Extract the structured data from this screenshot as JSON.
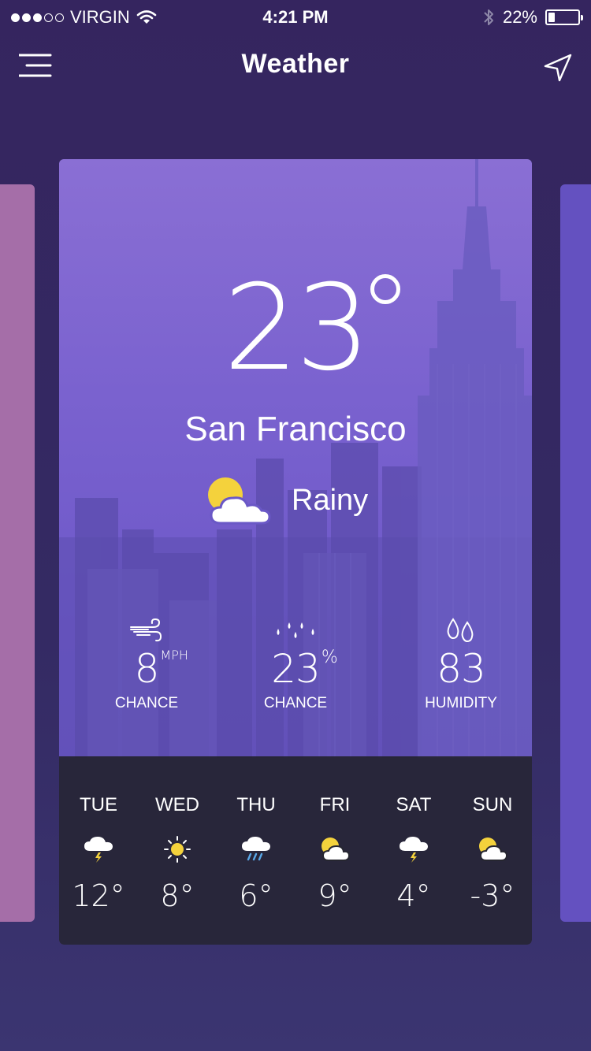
{
  "status_bar": {
    "carrier": "VIRGIN",
    "time": "4:21 PM",
    "battery": "22%",
    "battery_level": 0.22
  },
  "nav": {
    "title": "Weather"
  },
  "current": {
    "temperature": "23",
    "city": "San Francisco",
    "condition": "Rainy",
    "condition_icon": "partly-cloudy-icon"
  },
  "stats": [
    {
      "icon": "wind-icon",
      "value": "8",
      "unit": "MPH",
      "label": "CHANCE"
    },
    {
      "icon": "rain-drops-icon",
      "value": "23",
      "unit": "%",
      "label": "CHANCE"
    },
    {
      "icon": "humidity-icon",
      "value": "83",
      "unit": "",
      "label": "HUMIDITY"
    }
  ],
  "forecast": [
    {
      "day": "TUE",
      "icon": "storm-icon",
      "temp": "12°"
    },
    {
      "day": "WED",
      "icon": "sun-icon",
      "temp": "8°"
    },
    {
      "day": "THU",
      "icon": "rain-icon",
      "temp": "6°"
    },
    {
      "day": "FRI",
      "icon": "partly-cloudy-icon",
      "temp": "9°"
    },
    {
      "day": "SAT",
      "icon": "storm-icon",
      "temp": "4°"
    },
    {
      "day": "SUN",
      "icon": "partly-cloudy-icon",
      "temp": "-3°"
    }
  ],
  "colors": {
    "background": "#35255f",
    "card_top": "#8a6fd4",
    "card_bottom": "#6453c2",
    "forecast_panel": "#202028",
    "sun": "#f4d23c",
    "left_card": "#a56ea8",
    "right_card": "#6451c0"
  }
}
